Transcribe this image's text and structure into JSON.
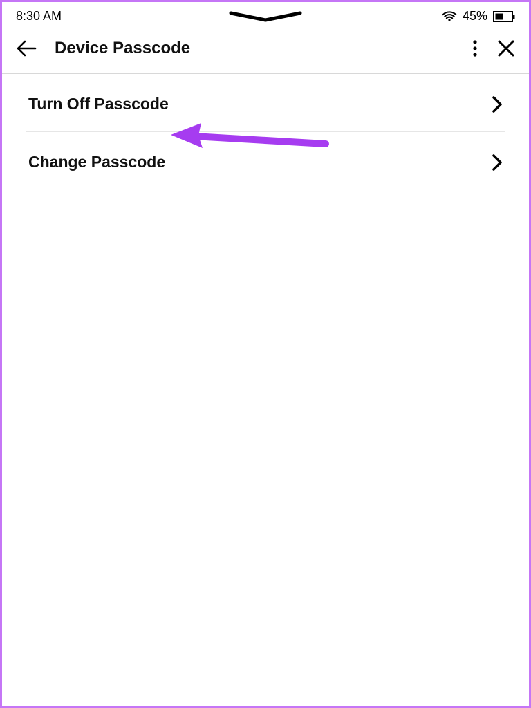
{
  "status": {
    "time": "8:30 AM",
    "battery_pct": "45%"
  },
  "header": {
    "title": "Device Passcode"
  },
  "items": [
    {
      "label": "Turn Off Passcode"
    },
    {
      "label": "Change Passcode"
    }
  ],
  "colors": {
    "annotation": "#a63cf0",
    "border": "#c576f6"
  }
}
